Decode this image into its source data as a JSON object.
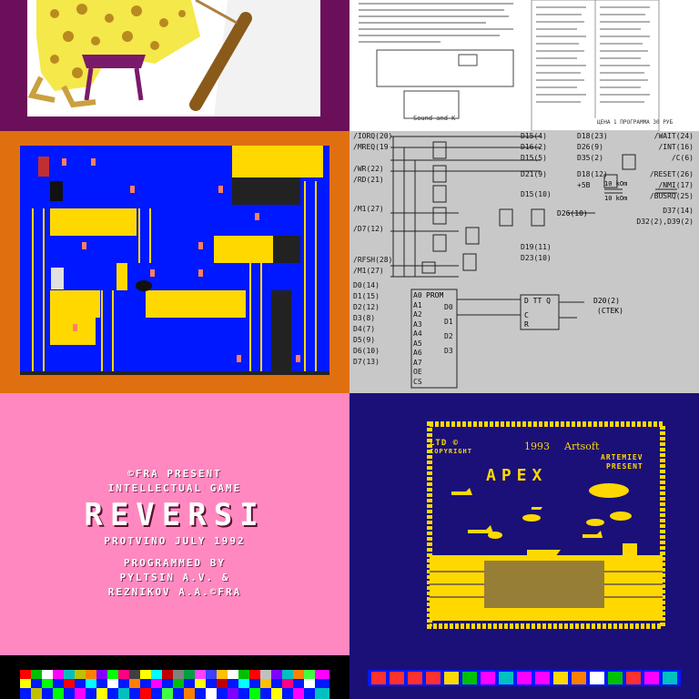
{
  "tiles": {
    "reversi": {
      "line1": "©FRA PRESENT",
      "line2": "INTELLECTUAL GAME",
      "title": "REVERSI",
      "line3": "PROTVINO JULY 1992",
      "line4": "PROGRAMMED BY",
      "line5": "PYLTSIN A.V. &",
      "line6": "REZNIKOV A.A.©FRA"
    },
    "apex": {
      "ltd": "LTD ©",
      "copyright": "COPYRIGHT",
      "year": "1993",
      "studio": "Artsoft",
      "author": "ARTEMIEV",
      "present": "PRESENT",
      "title": "APEX"
    },
    "schematic": {
      "pins_left": [
        "/IORQ(20)",
        "/MREQ(19",
        "/WR(22)",
        "/RD(21)",
        "/M1(27)",
        "/D7(12)",
        "/RFSH(28)",
        "/M1(27)",
        "D0(14)",
        "D1(15)",
        "D2(12)",
        "D3(8)",
        "D4(7)",
        "D5(9)",
        "D6(10)",
        "D7(13)"
      ],
      "pins_mid": [
        "D15(4)",
        "D16(2)",
        "D15(5)",
        "D21(9)",
        "D15(10)",
        "D19(11)",
        "D23(10)"
      ],
      "pins_right": [
        "D18(23)",
        "D26(9)",
        "D35(2)",
        "D18(12)",
        "+5B",
        "/WAIT(24)",
        "/INT(16)",
        "/C(6)",
        "/RESET(26)",
        "/NMI(17)",
        "/BUSRQ(25)",
        "D37(14)",
        "D32(2),D39(2)",
        "D26(10)",
        "D20(2)",
        "(CTEK)"
      ],
      "res1": "10 kOm",
      "res2": "10 kOm",
      "prom_label": "PROM",
      "prom_addr": [
        "A0",
        "A1",
        "A2",
        "A3",
        "A4",
        "A5",
        "A6",
        "A7",
        "OE",
        "CS"
      ],
      "prom_data": [
        "D0",
        "D1",
        "D2",
        "D3"
      ],
      "tt_label": "D TT Q",
      "tt_pins": [
        "C",
        "R"
      ]
    },
    "document": {
      "left_heading": "Sound and K",
      "footer_left": "ЦЕНА 1 ПРОГРАММА 30 РУБ",
      "ports": [
        "ПОРТ \"П\"",
        "К КОМПЬЮТЕРУ",
        "К ДЖОЙСТИКУ"
      ]
    }
  },
  "colors": {
    "purple": "#6b0f5a",
    "orange": "#e0700f",
    "pink": "#ff88c0",
    "navy": "#1a1078",
    "yellow": "#ffd800",
    "blue": "#0018ff",
    "gray": "#c8c8c8",
    "black": "#000000"
  },
  "icons": [
    "cheetah-art",
    "bat-icon",
    "ladder-icon",
    "brick-icon",
    "game-figure-icon",
    "circuit-gate-icon",
    "cloud-icon",
    "plane-icon",
    "ship-icon",
    "palette-strip",
    "toolbar-icons"
  ]
}
